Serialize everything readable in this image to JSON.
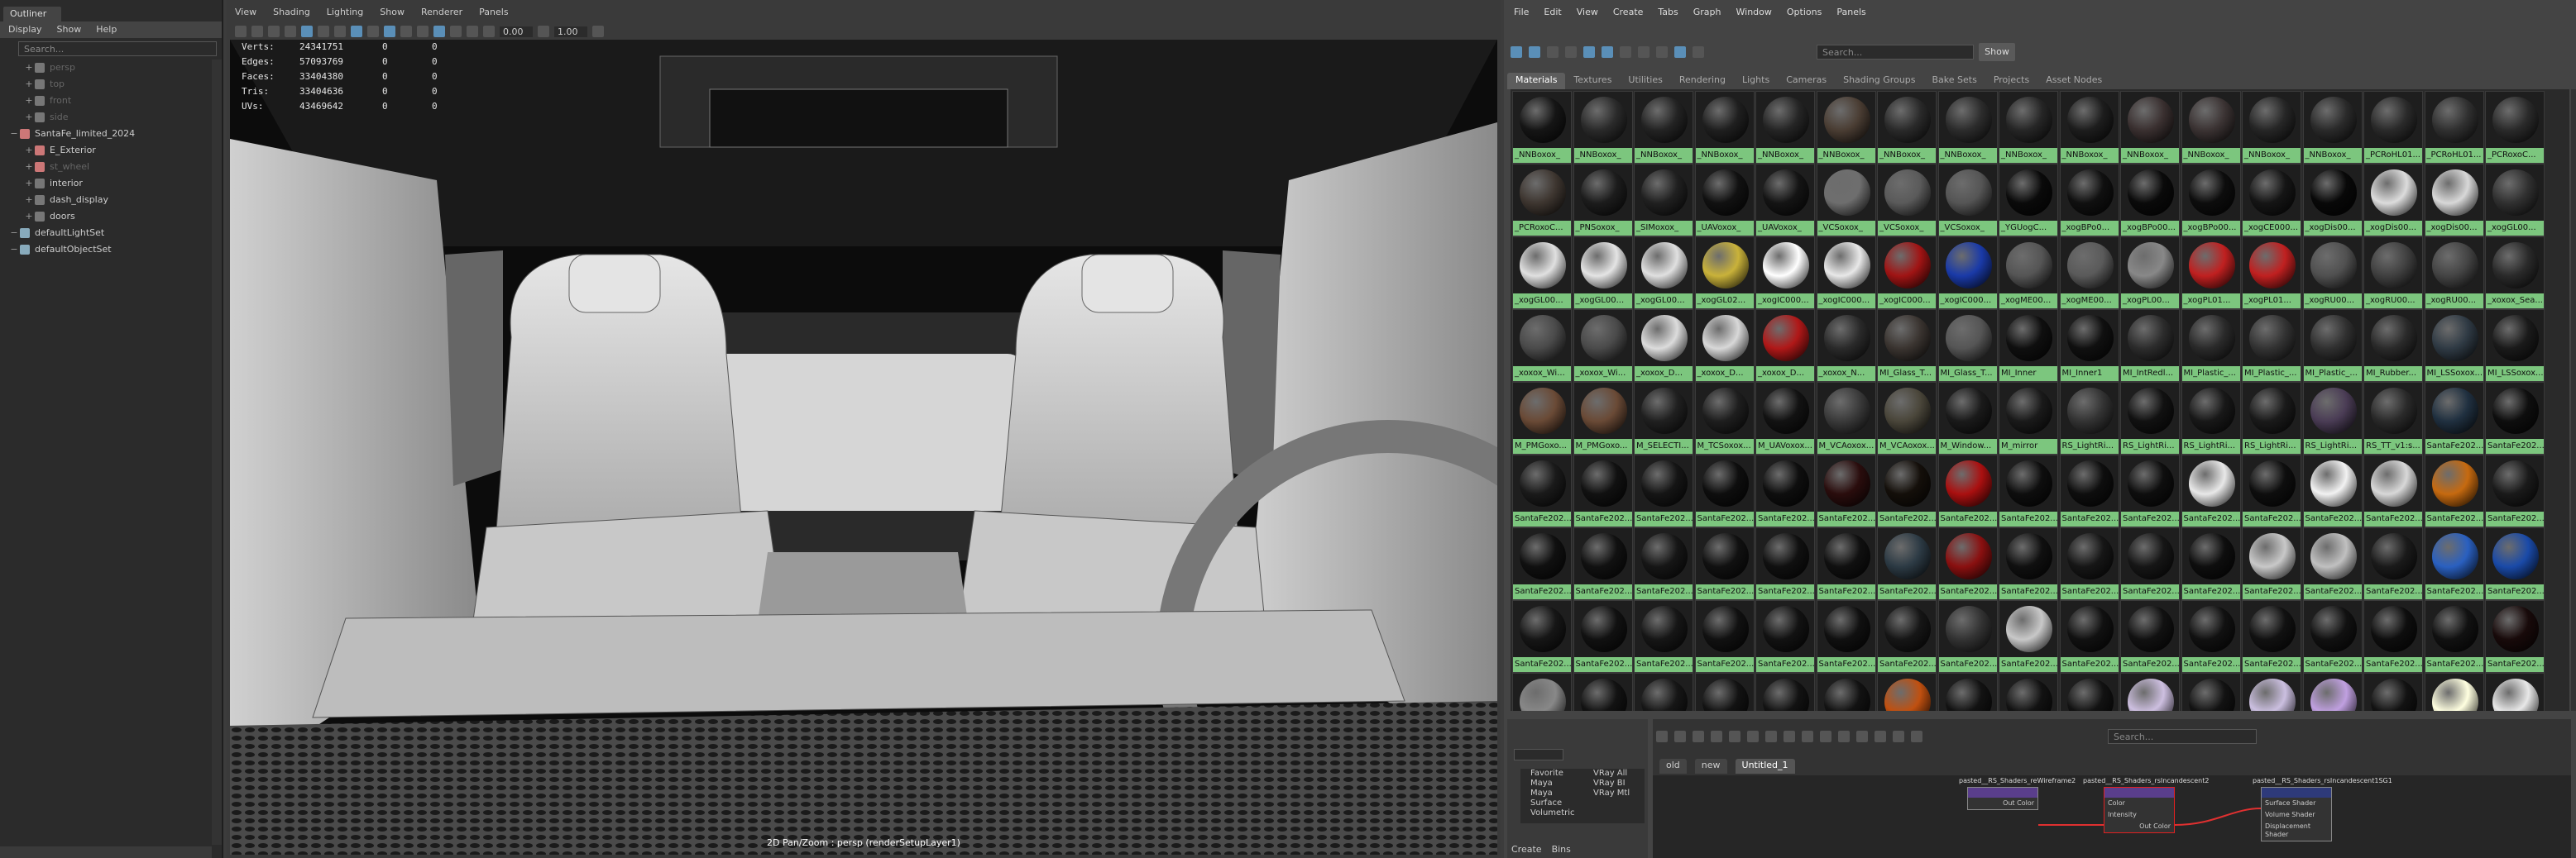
{
  "outliner": {
    "tab": "Outliner",
    "menu": [
      "Display",
      "Show",
      "Help"
    ],
    "search_placeholder": "Search...",
    "items": [
      {
        "label": "persp",
        "dim": true
      },
      {
        "label": "top",
        "dim": true
      },
      {
        "label": "front",
        "dim": true
      },
      {
        "label": "side",
        "dim": true
      },
      {
        "label": "SantaFe_limited_2024",
        "dim": false
      },
      {
        "label": "E_Exterior",
        "dim": false
      },
      {
        "label": "st_wheel",
        "dim": true
      },
      {
        "label": "interior",
        "dim": false
      },
      {
        "label": "dash_display",
        "dim": false
      },
      {
        "label": "doors",
        "dim": false
      },
      {
        "label": "defaultLightSet",
        "dim": false
      },
      {
        "label": "defaultObjectSet",
        "dim": false
      }
    ]
  },
  "viewport": {
    "menu": [
      "View",
      "Shading",
      "Lighting",
      "Show",
      "Renderer",
      "Panels"
    ],
    "field_a": "0.00",
    "field_b": "1.00",
    "hud": [
      {
        "k": "Verts:",
        "v": "24341751",
        "a": "0",
        "b": "0"
      },
      {
        "k": "Edges:",
        "v": "57093769",
        "a": "0",
        "b": "0"
      },
      {
        "k": "Faces:",
        "v": "33404380",
        "a": "0",
        "b": "0"
      },
      {
        "k": "Tris:",
        "v": "33404636",
        "a": "0",
        "b": "0"
      },
      {
        "k": "UVs:",
        "v": "43469642",
        "a": "0",
        "b": "0"
      }
    ],
    "camera_label": "2D Pan/Zoom : persp (renderSetupLayer1)"
  },
  "hypershade": {
    "menu": [
      "File",
      "Edit",
      "View",
      "Create",
      "Tabs",
      "Graph",
      "Window",
      "Options",
      "Panels"
    ],
    "search_placeholder": "Search...",
    "show_button": "Show",
    "tabs": [
      "Materials",
      "Textures",
      "Utilities",
      "Rendering",
      "Lights",
      "Cameras",
      "Shading Groups",
      "Bake Sets",
      "Projects",
      "Asset Nodes"
    ],
    "materials": [
      "_NNBoxox_",
      "_NNBoxox_",
      "_NNBoxox_",
      "_NNBoxox_",
      "_NNBoxox_",
      "_NNBoxox_",
      "_NNBoxox_",
      "_NNBoxox_",
      "_NNBoxox_",
      "_NNBoxox_",
      "_NNBoxox_",
      "_NNBoxox_",
      "_NNBoxox_",
      "_NNBoxox_",
      "_PCRoHL01...",
      "_PCRoHL01...",
      "_PCRoxoC...",
      "_PCRoxoC...",
      "_PNSoxox_",
      "_SIMoxox_",
      "_UAVoxox_",
      "_UAVoxox_",
      "_VCSoxox_",
      "_VCSoxox_",
      "_VCSoxox_",
      "_YGUogC...",
      "_xogBPo0...",
      "_xogBPo00...",
      "_xogBPo00...",
      "_xogCE000...",
      "_xogDis00...",
      "_xogDis00...",
      "_xogDis00...",
      "_xogGL00...",
      "_xogGL00...",
      "_xogGL00...",
      "_xogGL00...",
      "_xogGL02...",
      "_xogIC000...",
      "_xogIC000...",
      "_xogIC000...",
      "_xogIC000...",
      "_xogME00...",
      "_xogME00...",
      "_xogPL00...",
      "_xogPL01...",
      "_xogPL01...",
      "_xogRU00...",
      "_xogRU00...",
      "_xogRU00...",
      "_xoxox_Sea...",
      "_xoxox_Wi...",
      "_xoxox_Wi...",
      "_xoxox_D...",
      "_xoxox_D...",
      "_xoxox_D...",
      "_xoxox_N...",
      "MI_Glass_T...",
      "MI_Glass_T...",
      "MI_Inner",
      "MI_Inner1",
      "MI_IntRedl...",
      "MI_Plastic_...",
      "MI_Plastic_...",
      "MI_Plastic_...",
      "MI_Rubber...",
      "MI_LSSoxox...",
      "MI_LSSoxox...",
      "M_PMGoxo...",
      "M_PMGoxo...",
      "M_SELECTI...",
      "M_TCSoxox...",
      "M_UAVoxox...",
      "M_VCAoxox...",
      "M_VCAoxox...",
      "M_Window...",
      "M_mirror",
      "RS_LightRi...",
      "RS_LightRi...",
      "RS_LightRi...",
      "RS_LightRi...",
      "RS_LightRi...",
      "RS_TT_v1:s...",
      "SantaFe202...",
      "SantaFe202...",
      "SantaFe202...",
      "SantaFe202...",
      "SantaFe202...",
      "SantaFe202...",
      "SantaFe202...",
      "SantaFe202...",
      "SantaFe202...",
      "SantaFe202...",
      "SantaFe202...",
      "SantaFe202...",
      "SantaFe202...",
      "SantaFe202...",
      "SantaFe202...",
      "SantaFe202...",
      "SantaFe202...",
      "SantaFe202...",
      "SantaFe202...",
      "SantaFe202...",
      "SantaFe202...",
      "SantaFe202...",
      "SantaFe202...",
      "SantaFe202...",
      "SantaFe202...",
      "SantaFe202...",
      "SantaFe202...",
      "SantaFe202...",
      "SantaFe202...",
      "SantaFe202...",
      "SantaFe202...",
      "SantaFe202...",
      "SantaFe202...",
      "SantaFe202...",
      "SantaFe202...",
      "SantaFe202...",
      "SantaFe202...",
      "SantaFe202...",
      "SantaFe202...",
      "SantaFe202...",
      "SantaFe202...",
      "SantaFe202...",
      "SantaFe202...",
      "SantaFe202...",
      "SantaFe202...",
      "SantaFe202...",
      "SantaFe202...",
      "SantaFe202...",
      "SantaFe202...",
      "SantaFe202...",
      "SantaFe202...",
      "SantaFe202...",
      "SantaFe202...",
      "",
      "",
      "",
      "",
      "",
      "",
      "",
      "",
      "",
      "",
      "",
      "",
      "",
      "",
      "",
      "",
      ""
    ],
    "swatch_colors": [
      "#151515",
      "#2a2a2a",
      "#232323",
      "#1f1f1f",
      "#252525",
      "#4a3d33",
      "#2a2a2a",
      "#2c2c2c",
      "#262626",
      "#1d1d1d",
      "#3a3030",
      "#3b3333",
      "#262626",
      "#2a2a2a",
      "#2a2a2a",
      "#303030",
      "#2a2a2a",
      "#3e3630",
      "#1c1c1c",
      "#202020",
      "#111111",
      "#141414",
      "#6e6e6e",
      "#5a5a5a",
      "#555555",
      "#0a0a0a",
      "#101010",
      "#0a0a0a",
      "#0d0d0d",
      "#151515",
      "#080808",
      "#dcdcdc",
      "#d8d8d8",
      "#303030",
      "#e0e0e0",
      "#e4e4e4",
      "#e0e0e0",
      "#c9b23a",
      "#ffffff",
      "#e8e8e8",
      "#a01414",
      "#1a3aa8",
      "#555555",
      "#5a5a5a",
      "#888888",
      "#c02020",
      "#c02020",
      "#505050",
      "#404040",
      "#444444",
      "#2a2a2a",
      "#4a4a4a",
      "#4a4a4a",
      "#dcdcdc",
      "#d8d8d8",
      "#b01818",
      "#2a2a2a",
      "#3a3430",
      "#555555",
      "#0f0f0f",
      "#101010",
      "#2c2c2c",
      "#2a2a2a",
      "#333333",
      "#303030",
      "#2a2a2a",
      "#2f3a44",
      "#1a1a1a",
      "#6a4a36",
      "#6a4a36",
      "#202020",
      "#1e1e1e",
      "#121212",
      "#3a3a3a",
      "#4a463a",
      "#1a1a1a",
      "#1a1a1a",
      "#333333",
      "#111111",
      "#181818",
      "#1a1a1a",
      "#4a3c55",
      "#2a2a2a",
      "#203040",
      "#0e0e0e",
      "#1a1a1a",
      "#111111",
      "#151515",
      "#0e0e0e",
      "#0e0e0e",
      "#2a0d0d",
      "#140f0a",
      "#aa1010",
      "#0e0e0e",
      "#0e0e0e",
      "#0e0e0e",
      "#e8e8e8",
      "#0e0e0e",
      "#f2f2f2",
      "#d8d8d8",
      "#c66a10",
      "#1a1a1a",
      "#101010",
      "#111111",
      "#161616",
      "#111111",
      "#101010",
      "#101010",
      "#2c3a44",
      "#8a1010",
      "#101010",
      "#161616",
      "#161616",
      "#0e0e0e",
      "#c8c8c8",
      "#c0c0c0",
      "#1a1a1a",
      "#2a60c0",
      "#1a4aa8",
      "#161616",
      "#111111",
      "#161616",
      "#111111",
      "#121212",
      "#101010",
      "#161616",
      "#333333",
      "#c8c8c8",
      "#111111",
      "#111111",
      "#111111",
      "#111111",
      "#111111",
      "#0e0e0e",
      "#111111",
      "#180a0a",
      "#888888",
      "#121212",
      "#161616",
      "#121212",
      "#121212",
      "#121212",
      "#c05010",
      "#121212",
      "#121212",
      "#121212",
      "#cdbfe0",
      "#121212",
      "#cbbfe0",
      "#c0a0e0",
      "#121212",
      "#ffffe0",
      "#e8e8e8"
    ],
    "bottom_left": {
      "list": [
        "Favorite",
        "Maya",
        "Maya",
        "Surface",
        "Volumetric"
      ],
      "list2": [
        "VRay All",
        "VRay BI",
        "VRay Mtl"
      ],
      "tabs": [
        "Create",
        "Bins"
      ]
    },
    "graph_search_placeholder": "Search...",
    "graph_tabs": [
      "old",
      "new",
      "Untitled_1"
    ],
    "nodes": [
      {
        "title": "pasted__RS_Shaders_reWireframe2",
        "body": [
          "Out Color"
        ]
      },
      {
        "title": "pasted__RS_Shaders_rsIncandescent2",
        "body": [
          "Color",
          "Intensity",
          "Out Color"
        ]
      },
      {
        "title": "pasted__RS_Shaders_rsIncandescent1SG1",
        "body": [
          "Surface Shader",
          "Volume Shader",
          "Displacement Shader"
        ]
      }
    ]
  }
}
